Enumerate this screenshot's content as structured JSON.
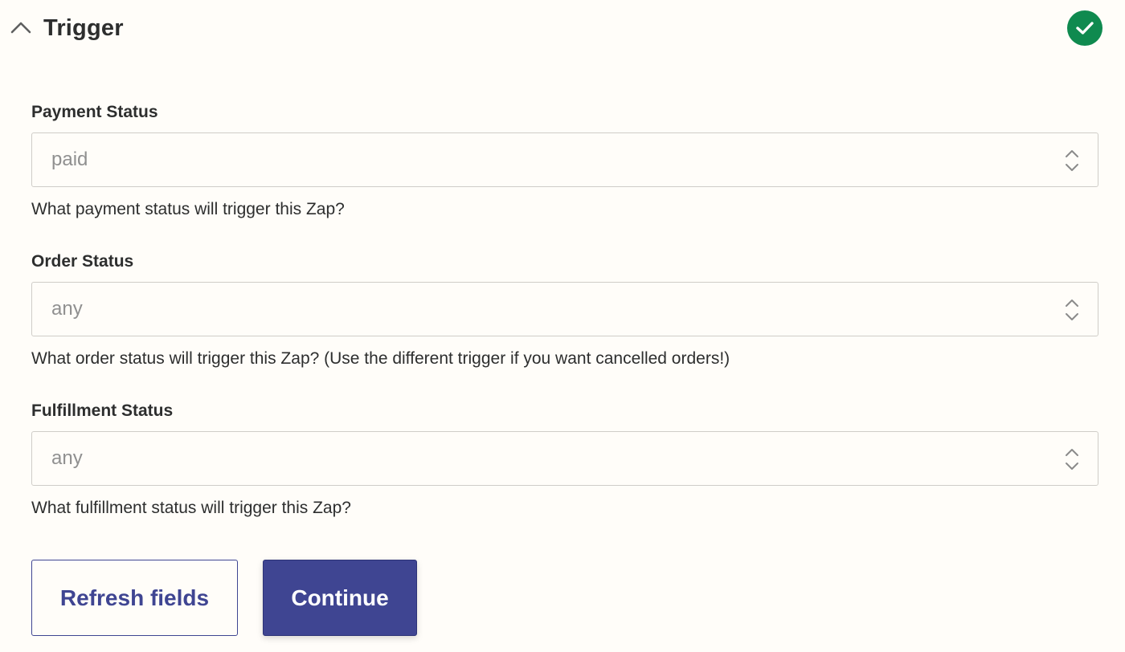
{
  "section": {
    "title": "Trigger",
    "collapse_icon": "chevron-up-icon",
    "status_icon": "check-circle-icon",
    "status_color": "#0f8a4f"
  },
  "fields": [
    {
      "label": "Payment Status",
      "value": "paid",
      "help": "What payment status will trigger this Zap?"
    },
    {
      "label": "Order Status",
      "value": "any",
      "help": "What order status will trigger this Zap? (Use the different trigger if you want cancelled orders!)"
    },
    {
      "label": "Fulfillment Status",
      "value": "any",
      "help": "What fulfillment status will trigger this Zap?"
    }
  ],
  "actions": {
    "refresh_label": "Refresh fields",
    "continue_label": "Continue",
    "accent_color": "#3f4592"
  }
}
